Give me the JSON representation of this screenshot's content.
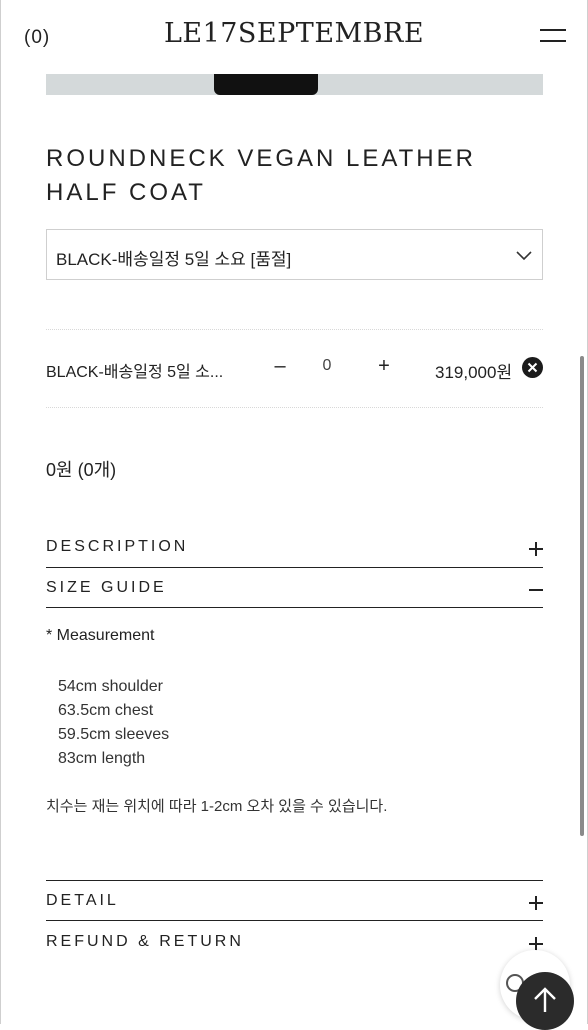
{
  "header": {
    "cart_count": "(0)",
    "logo": "LE17SEPTEMBRE"
  },
  "product": {
    "title": "ROUNDNECK VEGAN LEATHER HALF COAT",
    "selected_option": "BLACK-배송일정 5일 소요 [품절]"
  },
  "option_row": {
    "name": "BLACK-배송일정 5일 소...",
    "minus": "–",
    "quantity": "0",
    "plus": "+",
    "price": "319,000원"
  },
  "total": "0원 (0개)",
  "accordions": {
    "description": "DESCRIPTION",
    "size_guide": "SIZE GUIDE",
    "detail": "DETAIL",
    "refund": "REFUND & RETURN"
  },
  "size_guide": {
    "heading": "* Measurement",
    "items": [
      "54cm shoulder",
      "63.5cm chest",
      "59.5cm sleeves",
      "83cm length"
    ],
    "note": "치수는 재는 위치에 따라 1-2cm 오차 있을 수 있습니다."
  },
  "icons": {
    "menu": "hamburger-icon",
    "select": "chevron-down-icon",
    "remove": "close-circle-icon",
    "expand": "plus-icon",
    "collapse": "minus-icon",
    "back_to_top": "arrow-up-icon"
  }
}
